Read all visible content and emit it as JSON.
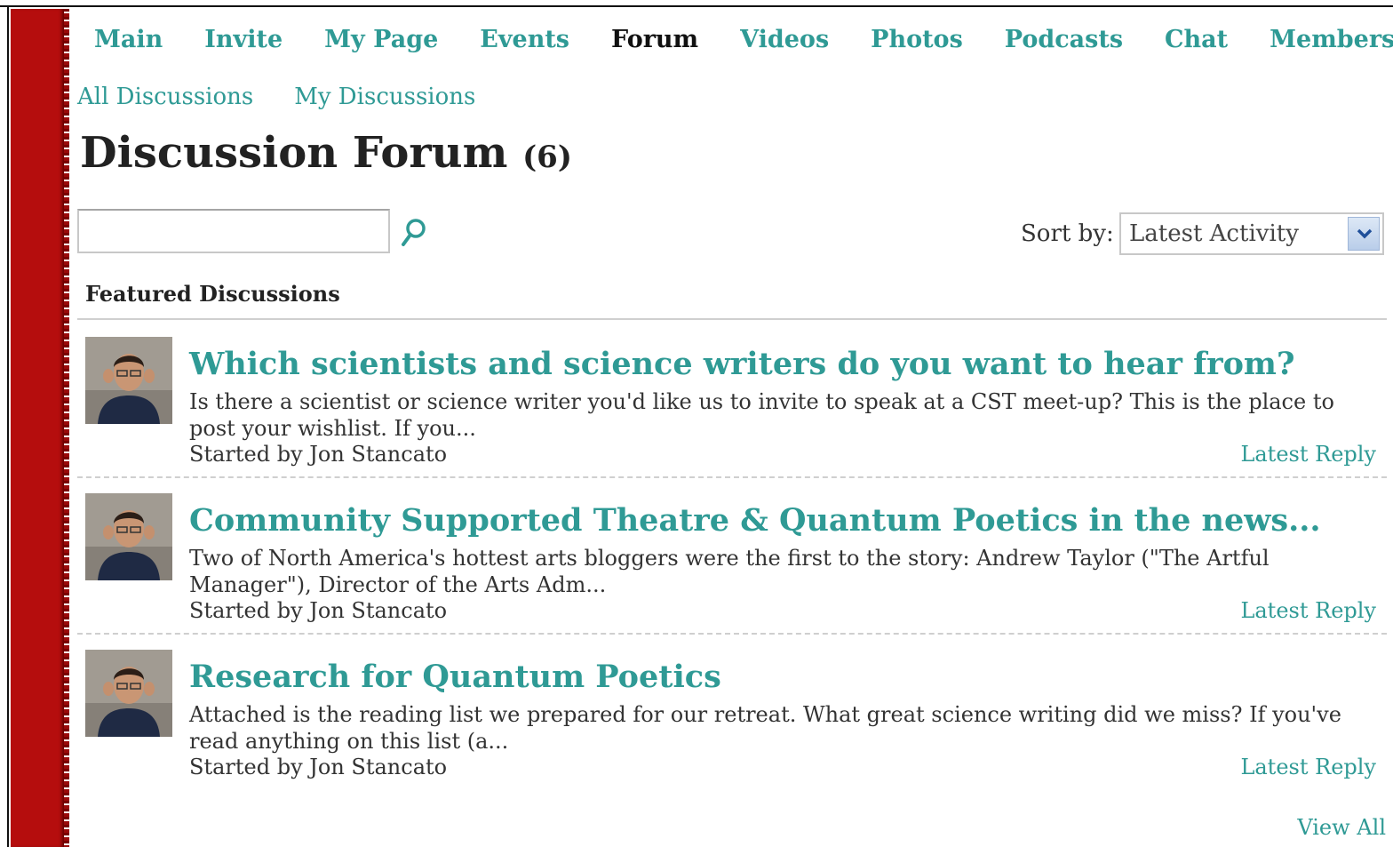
{
  "nav": {
    "items": [
      {
        "label": "Main",
        "active": false
      },
      {
        "label": "Invite",
        "active": false
      },
      {
        "label": "My Page",
        "active": false
      },
      {
        "label": "Events",
        "active": false
      },
      {
        "label": "Forum",
        "active": true
      },
      {
        "label": "Videos",
        "active": false
      },
      {
        "label": "Photos",
        "active": false
      },
      {
        "label": "Podcasts",
        "active": false
      },
      {
        "label": "Chat",
        "active": false
      },
      {
        "label": "Members",
        "active": false
      }
    ]
  },
  "subnav": {
    "items": [
      {
        "label": "All Discussions"
      },
      {
        "label": "My Discussions"
      }
    ]
  },
  "page": {
    "title": "Discussion Forum",
    "count": "(6)"
  },
  "search": {
    "value": "",
    "icon": "magnifier-icon"
  },
  "sort": {
    "label": "Sort by:",
    "selected": "Latest Activity"
  },
  "featured": {
    "heading": "Featured Discussions",
    "discussions": [
      {
        "title": "Which scientists and science writers do you want to hear from?",
        "excerpt": "Is there a scientist or science writer you'd like us to invite to speak at a CST meet-up? This is the place to post your wishlist. If you...",
        "author": "Started by Jon Stancato",
        "reply_label": "Latest Reply"
      },
      {
        "title": "Community Supported Theatre & Quantum Poetics in the news...",
        "excerpt": "Two of North America's hottest arts bloggers were the first to the story: Andrew Taylor (\"The Artful Manager\"), Director of the Arts Adm...",
        "author": "Started by Jon Stancato",
        "reply_label": "Latest Reply"
      },
      {
        "title": "Research for Quantum Poetics",
        "excerpt": "Attached is the reading list we prepared for our retreat. What great science writing did we miss? If you've read anything on this list (a...",
        "author": "Started by Jon Stancato",
        "reply_label": "Latest Reply"
      }
    ],
    "view_all": "View All"
  },
  "colors": {
    "accent": "#2f9a95",
    "sidebar_red": "#b50d0d",
    "text": "#222222"
  }
}
